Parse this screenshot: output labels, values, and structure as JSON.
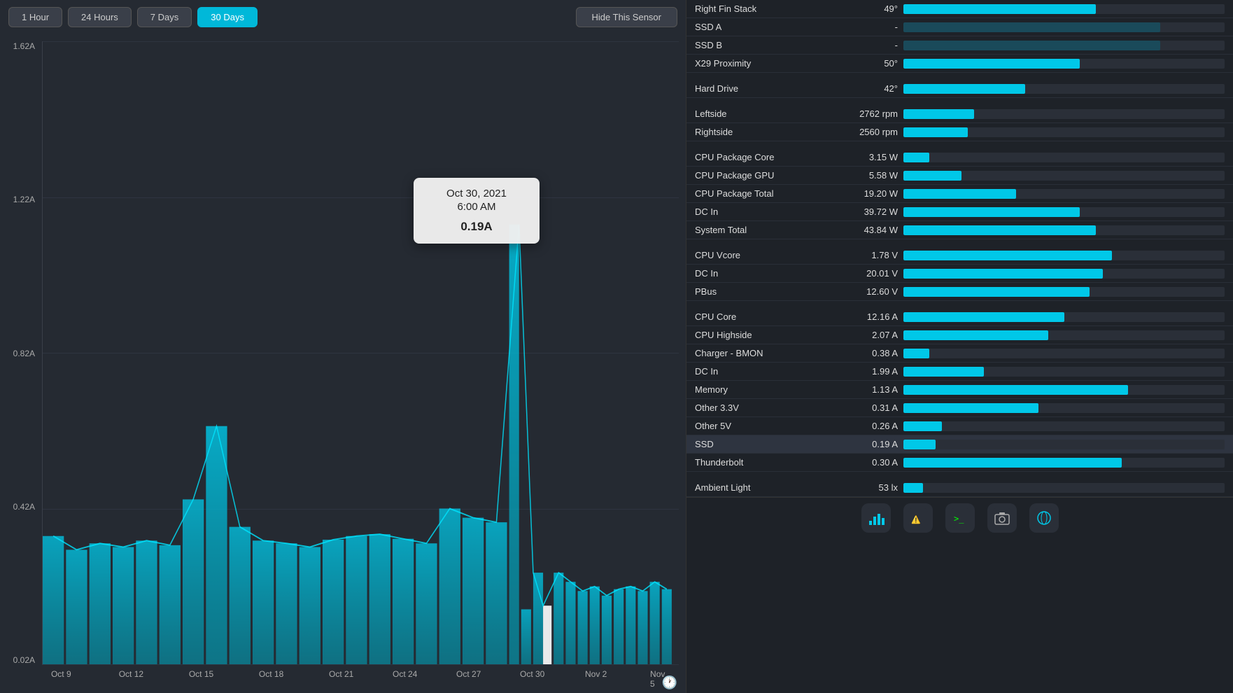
{
  "toolbar": {
    "btn1": "1 Hour",
    "btn24": "24 Hours",
    "btn7": "7 Days",
    "btn30": "30 Days",
    "hide": "Hide This Sensor"
  },
  "chart": {
    "y_labels": [
      "1.62A",
      "1.22A",
      "0.82A",
      "0.42A",
      "0.02A"
    ],
    "x_labels": [
      "Oct 9",
      "Oct 12",
      "Oct 15",
      "Oct 18",
      "Oct 21",
      "Oct 24",
      "Oct 27",
      "Oct 30",
      "Nov 2",
      "Nov 5"
    ]
  },
  "tooltip": {
    "date": "Oct 30, 2021",
    "time": "6:00 AM",
    "value": "0.19A"
  },
  "sensors": [
    {
      "group": true
    },
    {
      "name": "Right Fin Stack",
      "value": "49°",
      "bar": 60,
      "dark": false
    },
    {
      "name": "SSD A",
      "value": "-",
      "bar": 80,
      "dark": true
    },
    {
      "name": "SSD B",
      "value": "-",
      "bar": 80,
      "dark": true
    },
    {
      "name": "X29 Proximity",
      "value": "50°",
      "bar": 55,
      "dark": false
    },
    {
      "divider": true
    },
    {
      "name": "Hard Drive",
      "value": "42°",
      "bar": 38,
      "dark": false
    },
    {
      "divider": true
    },
    {
      "name": "Leftside",
      "value": "2762 rpm",
      "bar": 22,
      "dark": false
    },
    {
      "name": "Rightside",
      "value": "2560 rpm",
      "bar": 20,
      "dark": false
    },
    {
      "divider": true
    },
    {
      "name": "CPU Package Core",
      "value": "3.15 W",
      "bar": 8,
      "dark": false
    },
    {
      "name": "CPU Package GPU",
      "value": "5.58 W",
      "bar": 18,
      "dark": false
    },
    {
      "name": "CPU Package Total",
      "value": "19.20 W",
      "bar": 35,
      "dark": false
    },
    {
      "name": "DC In",
      "value": "39.72 W",
      "bar": 55,
      "dark": false
    },
    {
      "name": "System Total",
      "value": "43.84 W",
      "bar": 60,
      "dark": false
    },
    {
      "divider": true
    },
    {
      "name": "CPU Vcore",
      "value": "1.78 V",
      "bar": 65,
      "dark": false
    },
    {
      "name": "DC In",
      "value": "20.01 V",
      "bar": 62,
      "dark": false
    },
    {
      "name": "PBus",
      "value": "12.60 V",
      "bar": 58,
      "dark": false
    },
    {
      "divider": true
    },
    {
      "name": "CPU Core",
      "value": "12.16 A",
      "bar": 50,
      "dark": false
    },
    {
      "name": "CPU Highside",
      "value": "2.07 A",
      "bar": 45,
      "dark": false
    },
    {
      "name": "Charger - BMON",
      "value": "0.38 A",
      "bar": 8,
      "dark": false
    },
    {
      "name": "DC In",
      "value": "1.99 A",
      "bar": 25,
      "dark": false
    },
    {
      "name": "Memory",
      "value": "1.13 A",
      "bar": 70,
      "dark": false
    },
    {
      "name": "Other 3.3V",
      "value": "0.31 A",
      "bar": 42,
      "dark": false
    },
    {
      "name": "Other 5V",
      "value": "0.26 A",
      "bar": 12,
      "dark": false
    },
    {
      "name": "SSD",
      "value": "0.19 A",
      "bar": 10,
      "dark": false,
      "highlighted": true
    },
    {
      "name": "Thunderbolt",
      "value": "0.30 A",
      "bar": 68,
      "dark": false
    },
    {
      "divider": true
    },
    {
      "name": "Ambient Light",
      "value": "53 lx",
      "bar": 6,
      "dark": false
    }
  ],
  "dock_icons": [
    "activity_monitor",
    "console",
    "terminal",
    "image_capture",
    "marble_it"
  ]
}
